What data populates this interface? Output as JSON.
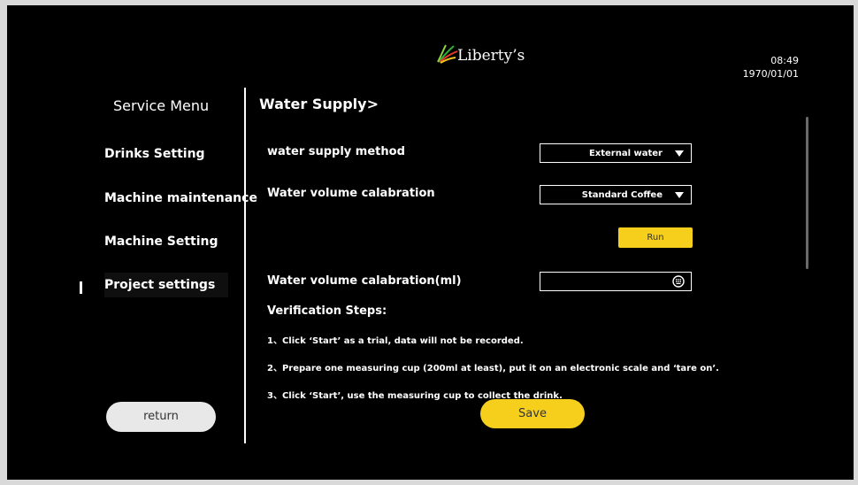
{
  "header": {
    "logo_text": "Liberty’s",
    "time": "08:49",
    "date": "1970/01/01"
  },
  "sidebar": {
    "title": "Service Menu",
    "items": [
      {
        "label": "Drinks Setting"
      },
      {
        "label": "Machine maintenance"
      },
      {
        "label": "Machine Setting"
      },
      {
        "label": "Project settings"
      }
    ],
    "active_index": 3,
    "return_label": "return"
  },
  "main": {
    "title": "Water Supply>",
    "fields": {
      "supply_method": {
        "label": "water supply method",
        "value": "External water"
      },
      "volume_calibration": {
        "label": "Water volume calabration",
        "value": "Standard Coffee"
      },
      "run_label": "Run",
      "volume_ml": {
        "label": "Water volume calabration(ml)",
        "value": ""
      }
    },
    "verification": {
      "title": "Verification Steps:",
      "steps": [
        "1、Click ‘Start’ as a trial, data will not be recorded.",
        "2、Prepare one measuring cup (200ml at least), put it on an electronic scale and ‘tare on’.",
        "3、Click ‘Start’, use the measuring cup to collect the drink."
      ]
    },
    "save_label": "Save"
  },
  "colors": {
    "background": "#000000",
    "accent": "#f6cf1d",
    "text": "#ffffff"
  }
}
